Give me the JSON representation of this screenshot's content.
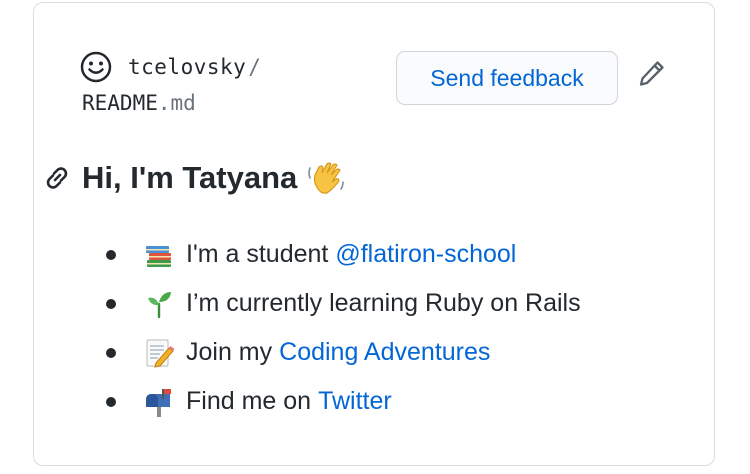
{
  "header": {
    "owner": "tcelovsky",
    "separator": "/",
    "file_name": "README",
    "file_ext": ".md",
    "feedback_label": "Send feedback"
  },
  "readme": {
    "heading": "Hi, I'm Tatyana",
    "items": [
      {
        "text": "I'm a student",
        "link": "@flatiron-school",
        "emoji": "books-emoji"
      },
      {
        "text": "I’m currently learning Ruby on Rails",
        "link": "",
        "emoji": "seedling-emoji"
      },
      {
        "text": "Join my",
        "link": "Coding Adventures",
        "emoji": "memo-emoji"
      },
      {
        "text": "Find me on",
        "link": "Twitter",
        "emoji": "mailbox-emoji"
      }
    ]
  },
  "colors": {
    "link": "#0366d6",
    "text": "#24292e",
    "muted": "#6a737d",
    "border": "#d9dcdf"
  }
}
